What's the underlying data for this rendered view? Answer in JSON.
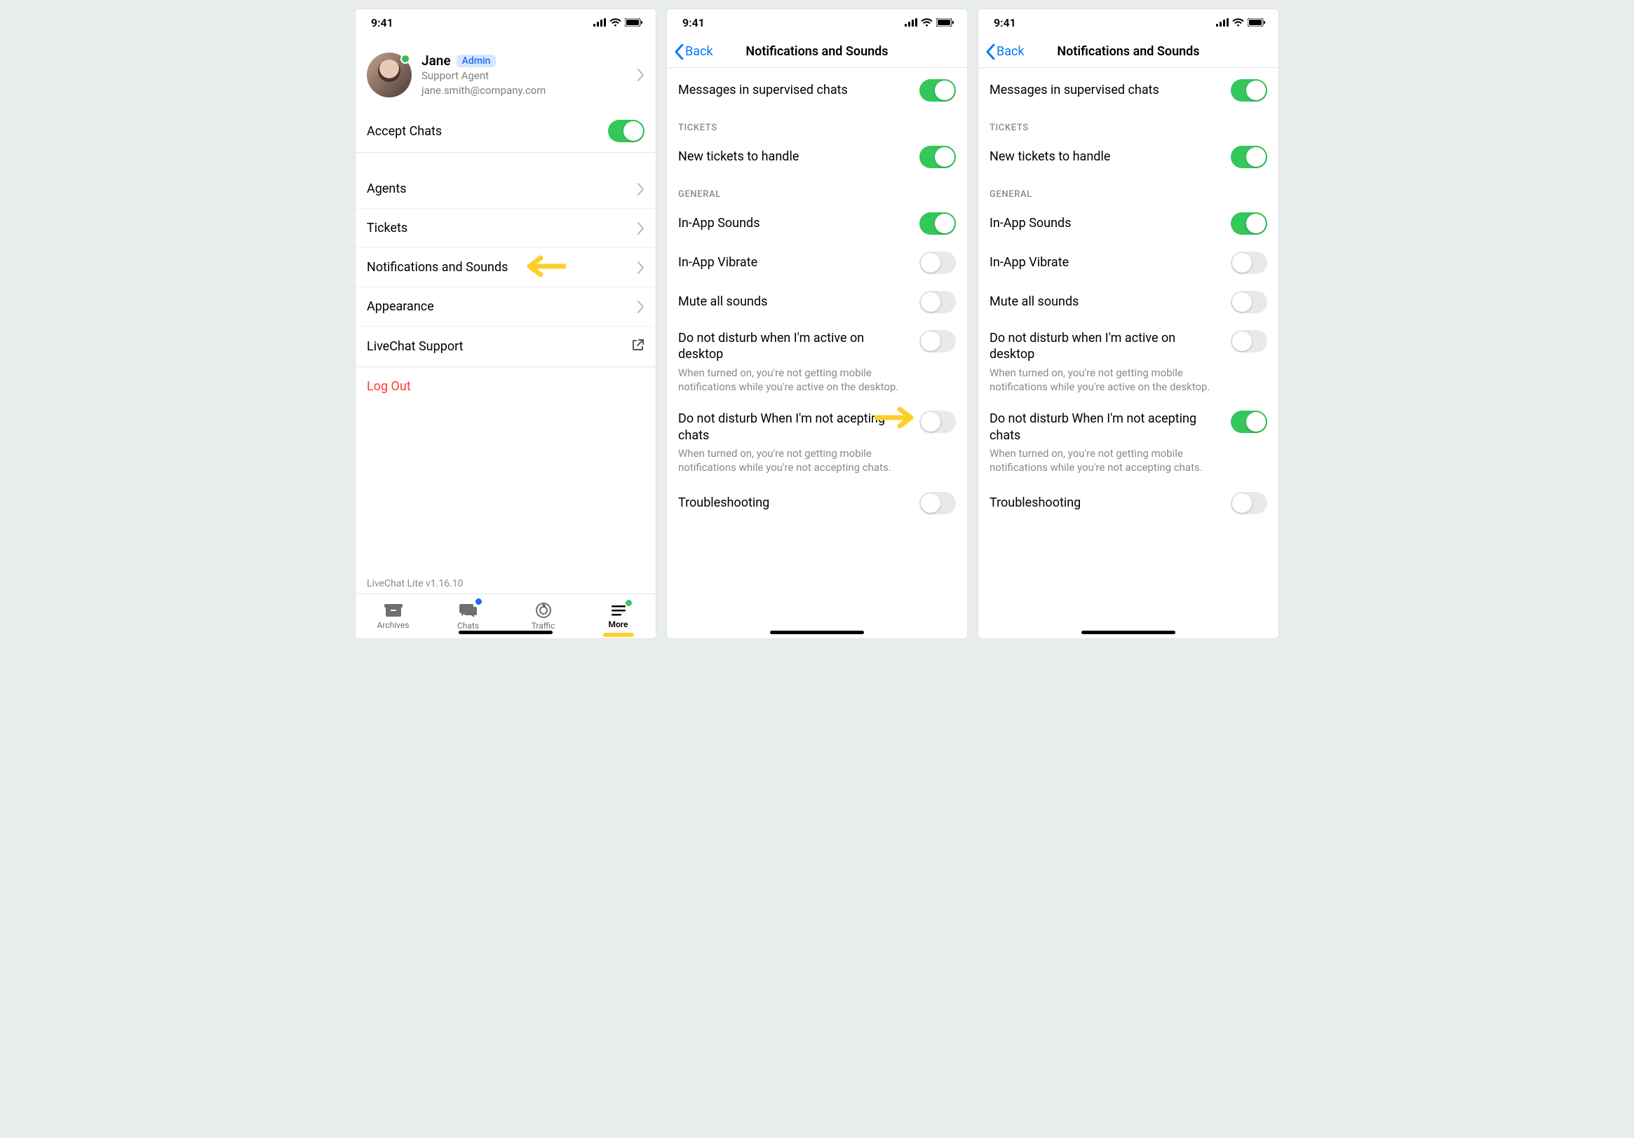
{
  "status_bar": {
    "time": "9:41"
  },
  "screen1": {
    "user": {
      "name": "Jane",
      "badge": "Admin",
      "role": "Support Agent",
      "email": "jane.smith@company.com"
    },
    "accept_chats": {
      "label": "Accept Chats",
      "on": true
    },
    "menu": {
      "agents": "Agents",
      "tickets": "Tickets",
      "notifications": "Notifications and Sounds",
      "appearance": "Appearance",
      "support": "LiveChat Support",
      "logout": "Log Out"
    },
    "version": "LiveChat Lite v1.16.10",
    "tabs": {
      "archives": "Archives",
      "chats": "Chats",
      "traffic": "Traffic",
      "more": "More"
    }
  },
  "screen2": {
    "back": "Back",
    "title": "Notifications and Sounds",
    "rows": {
      "supervised": {
        "label": "Messages in supervised chats",
        "on": true
      },
      "tickets_header": "TICKETS",
      "new_tickets": {
        "label": "New tickets to handle",
        "on": true
      },
      "general_header": "GENERAL",
      "in_app_sounds": {
        "label": "In-App Sounds",
        "on": true
      },
      "in_app_vibrate": {
        "label": "In-App Vibrate",
        "on": false
      },
      "mute_all": {
        "label": "Mute all sounds",
        "on": false
      },
      "dnd_desktop": {
        "label": "Do not disturb when I'm active on desktop",
        "desc": "When turned on, you're not getting mobile notifications while you're active on the desktop.",
        "on": false
      },
      "dnd_not_accepting": {
        "label": "Do not disturb When I'm not acepting chats",
        "desc": "When turned on, you're not getting mobile notifications while you're not accepting chats.",
        "on": false
      },
      "troubleshooting": {
        "label": "Troubleshooting",
        "on": false
      }
    }
  },
  "screen3": {
    "back": "Back",
    "title": "Notifications and Sounds",
    "rows": {
      "supervised": {
        "label": "Messages in supervised chats",
        "on": true
      },
      "tickets_header": "TICKETS",
      "new_tickets": {
        "label": "New tickets to handle",
        "on": true
      },
      "general_header": "GENERAL",
      "in_app_sounds": {
        "label": "In-App Sounds",
        "on": true
      },
      "in_app_vibrate": {
        "label": "In-App Vibrate",
        "on": false
      },
      "mute_all": {
        "label": "Mute all sounds",
        "on": false
      },
      "dnd_desktop": {
        "label": "Do not disturb when I'm active on desktop",
        "desc": "When turned on, you're not getting mobile notifications while you're active on the desktop.",
        "on": false
      },
      "dnd_not_accepting": {
        "label": "Do not disturb When I'm not acepting chats",
        "desc": "When turned on, you're not getting mobile notifications while you're not accepting chats.",
        "on": true
      },
      "troubleshooting": {
        "label": "Troubleshooting",
        "on": false
      }
    }
  }
}
